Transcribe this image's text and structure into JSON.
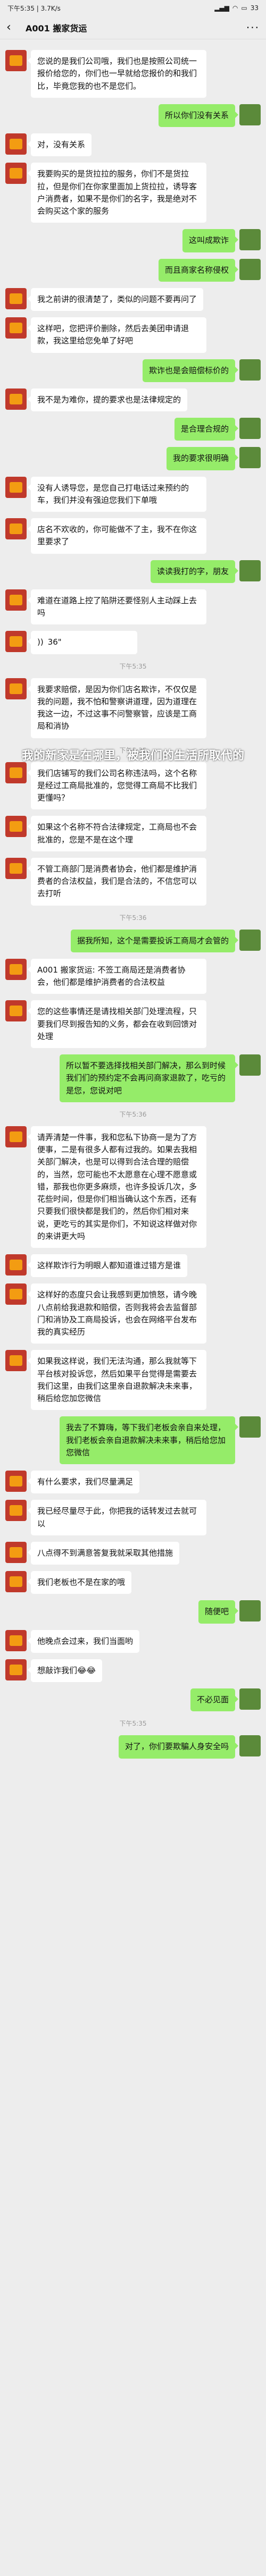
{
  "status": {
    "time": "下午5:35 | 3.7K/s",
    "battery": "33"
  },
  "header": {
    "title": "A001 搬家货运",
    "back": "‹",
    "more": "···"
  },
  "watermark": "我的新家是在哪里，被我们的生活所取代的",
  "messages": [
    {
      "type": "msg",
      "side": "left",
      "text": "您说的是我们公司哦，我们也是按照公司统一报价给您的，你们也一早就给您报价的和我们比，毕竟您我的也不是您们。"
    },
    {
      "type": "msg",
      "side": "right",
      "text": "所以你们没有关系"
    },
    {
      "type": "msg",
      "side": "left",
      "text": "对，没有关系"
    },
    {
      "type": "msg",
      "side": "left",
      "text": "我要购买的是货拉拉的服务，你们不是货拉拉，但是你们在你家里面加上货拉拉，诱导客户消费者，如果不是你们的名字，我是绝对不会购买这个家的服务"
    },
    {
      "type": "msg",
      "side": "right",
      "text": "这叫成欺诈"
    },
    {
      "type": "msg",
      "side": "right",
      "text": "而且商家名称侵权"
    },
    {
      "type": "msg",
      "side": "left",
      "text": "我之前讲的很清楚了，类似的问题不要再问了"
    },
    {
      "type": "msg",
      "side": "left",
      "text": "这样吧，您把评价删除，然后去美团申请退款，我这里给您免单了好吧"
    },
    {
      "type": "msg",
      "side": "right",
      "text": "欺诈也是会赔偿标价的"
    },
    {
      "type": "msg",
      "side": "left",
      "text": "我不是为难你，提的要求也是法律规定的"
    },
    {
      "type": "msg",
      "side": "right",
      "text": "是合理合规的"
    },
    {
      "type": "msg",
      "side": "right",
      "text": "我的要求很明确"
    },
    {
      "type": "msg",
      "side": "left",
      "text": "没有人诱导您，是您自己打电话过来预约的车，我们并没有强迫您我们下单哦"
    },
    {
      "type": "msg",
      "side": "left",
      "text": "店名不欢收的，你可能做不了主，我不在你这里要求了"
    },
    {
      "type": "msg",
      "side": "right",
      "text": "读读我打的字，朋友"
    },
    {
      "type": "msg",
      "side": "left",
      "text": "难道在道路上控了陷阱还要怪别人主动踩上去吗"
    },
    {
      "type": "voice",
      "side": "left",
      "text": "36\""
    },
    {
      "type": "time",
      "text": "下午5:35"
    },
    {
      "type": "msg",
      "side": "left",
      "text": "我要求赔偿，是因为你们店名欺诈，不仅仅是我的问题，我不怕和警察讲道理，因为道理在我这一边，不过这事不问警察管，应该是工商局和消协"
    },
    {
      "type": "time",
      "text": "下午5:35"
    },
    {
      "type": "msg",
      "side": "left",
      "text": "我们店铺写的我们公司名称违法吗，这个名称是经过工商局批准的，您觉得工商局不比我们更懂吗？"
    },
    {
      "type": "msg",
      "side": "left",
      "text": "如果这个名称不符合法律规定，工商局也不会批准的，您是不是在这个理"
    },
    {
      "type": "msg",
      "side": "left",
      "text": "不管工商部门是消费者协会，他们都是维护消费者的合法权益，我们是合法的，不信您可以去打听"
    },
    {
      "type": "time",
      "text": "下午5:36"
    },
    {
      "type": "msg",
      "side": "right",
      "text": "据我所知，这个是需要投诉工商局才会管的"
    },
    {
      "type": "msg",
      "side": "left",
      "text": "A001 搬家货运: 不签工商局还是消费者协会，他们都是维护消费者的合法权益"
    },
    {
      "type": "msg",
      "side": "left",
      "text": "您的这些事情还是请找相关部门处理流程，只要我们尽到报告知的义务，都会在收到回馈对处理"
    },
    {
      "type": "msg",
      "side": "right",
      "text": "所以暂不要选择找相关部门解决，那么到时候我们们的预约定不会再问商家退款了，吃亏的是您，您说对吧"
    },
    {
      "type": "time",
      "text": "下午5:36"
    },
    {
      "type": "msg",
      "side": "left",
      "text": "请弄清楚一件事，我和您私下协商一是为了方便事，二是有很多人都有过我的。如果去我相关部门解决，也是可以得到合法合理的赔偿的，当然，您可能也不太愿意在心理不愿意或错，那我也你更多麻烦，也许多投诉几次，多花些时间，但是你们相当确认这个东西，还有只要我们很快都是我们的，然后你们相对来说，更吃亏的其实是你们，不知说这样做对你的来讲更大吗"
    },
    {
      "type": "msg",
      "side": "left",
      "text": "这样欺诈行为明眼人都知道谁过错方是谁"
    },
    {
      "type": "msg",
      "side": "left",
      "text": "这样好的态度只会让我感到更加愤怒，请今晚八点前给我退款和赔偿，否则我将会去监督部门和消协及工商局投诉，也会在网络平台发布我的真实经历"
    },
    {
      "type": "msg",
      "side": "left",
      "text": "如果我这样说，我们无法沟通，那么我就等下平台核对投诉您，然后如果平台觉得是需要去我们这里，由我们这里亲自退款解决未来事，稍后给您加您微信"
    },
    {
      "type": "msg",
      "side": "right",
      "text": "我去了不算嗨，等下我们老板会亲自来处理，我们老板会亲自退款解决未来事，稍后给您加您微信"
    },
    {
      "type": "msg",
      "side": "left",
      "text": "有什么要求，我们尽量满足"
    },
    {
      "type": "msg",
      "side": "left",
      "text": "我已经尽量尽于此，你把我的话转发过去就可以"
    },
    {
      "type": "msg",
      "side": "left",
      "text": "八点得不到满意答复我就采取其他措施"
    },
    {
      "type": "msg",
      "side": "left",
      "text": "我们老板也不是在家的哦"
    },
    {
      "type": "msg",
      "side": "right",
      "text": "随便吧"
    },
    {
      "type": "msg",
      "side": "left",
      "text": "他晚点会过来，我们当面哟"
    },
    {
      "type": "msg",
      "side": "left",
      "text": "想敲诈我们😂😂"
    },
    {
      "type": "msg",
      "side": "right",
      "text": "不必见面"
    },
    {
      "type": "time",
      "text": "下午5:35"
    },
    {
      "type": "msg",
      "side": "right",
      "text": "对了，你们要欺騙人身安全吗"
    }
  ]
}
